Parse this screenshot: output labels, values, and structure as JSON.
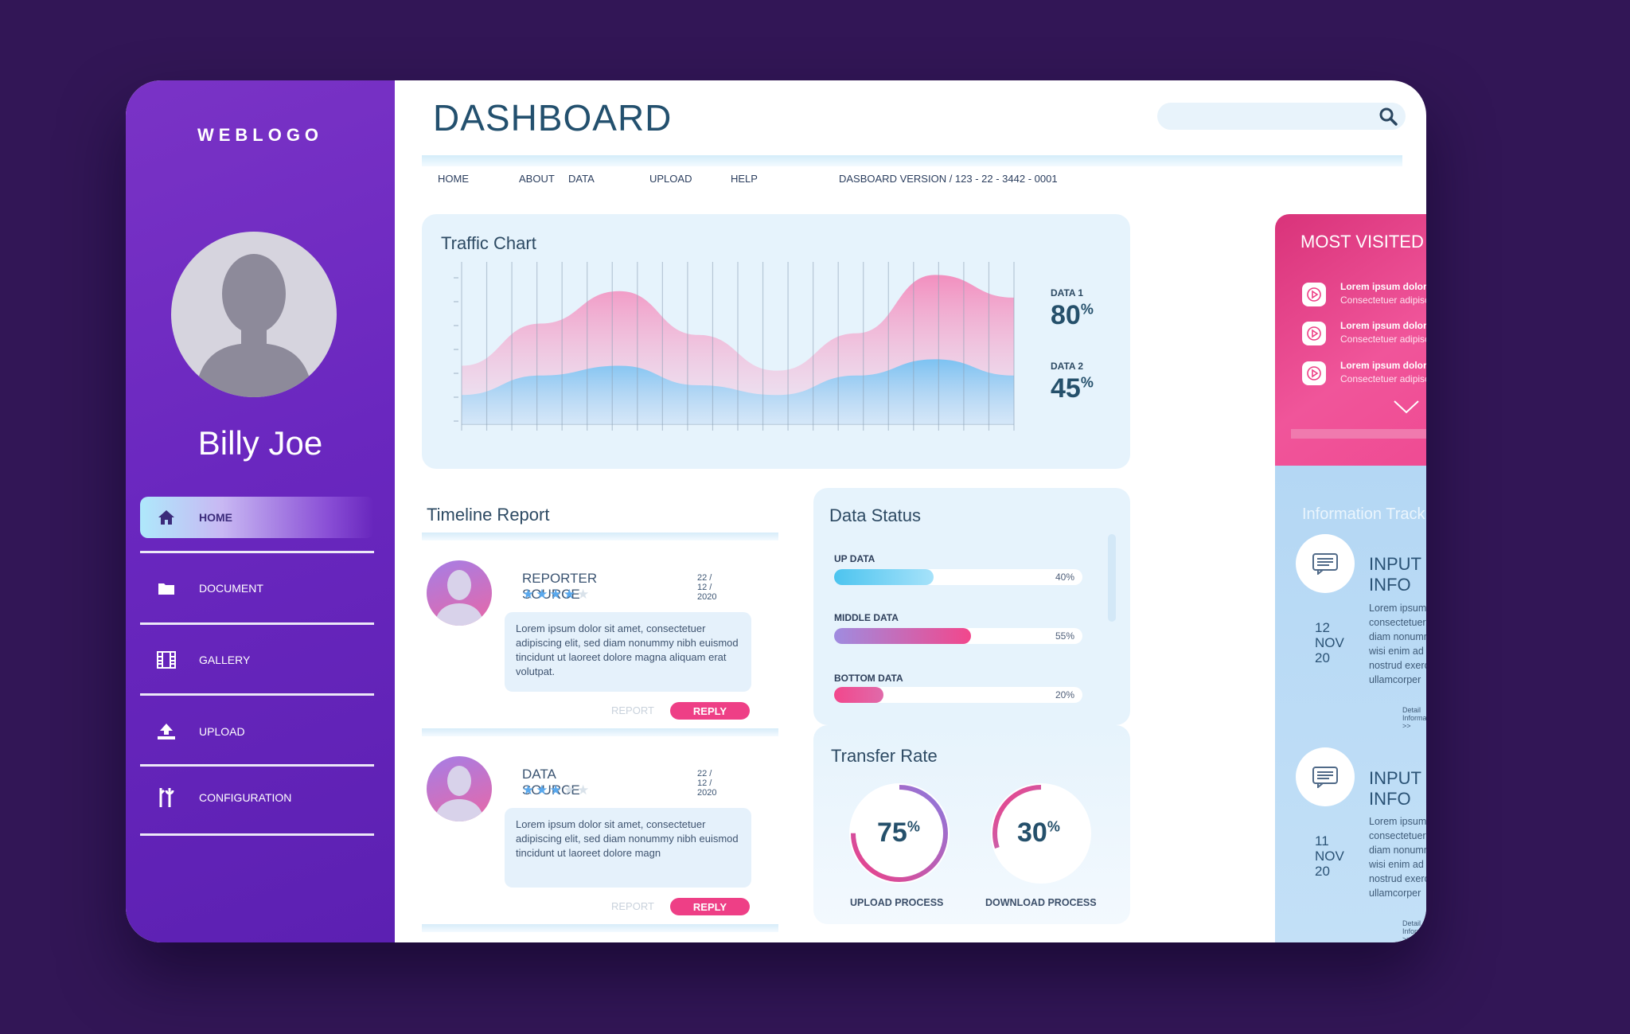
{
  "sidebar": {
    "logo": "WEBLOGO",
    "user_name": "Billy Joe",
    "items": [
      {
        "label": "HOME",
        "icon": "home-icon"
      },
      {
        "label": "DOCUMENT",
        "icon": "folder-icon"
      },
      {
        "label": "GALLERY",
        "icon": "film-icon"
      },
      {
        "label": "UPLOAD",
        "icon": "upload-icon"
      },
      {
        "label": "CONFIGURATION",
        "icon": "tools-icon"
      }
    ]
  },
  "header": {
    "title": "DASHBOARD",
    "search_placeholder": "",
    "nav": [
      "HOME",
      "ABOUT",
      "DATA",
      "UPLOAD",
      "HELP"
    ],
    "version": "DASBOARD VERSION / 123 - 22 - 3442 - 0001"
  },
  "traffic": {
    "title": "Traffic Chart",
    "data1_label": "DATA 1",
    "data1_value": "80",
    "data2_label": "DATA 2",
    "data2_value": "45",
    "pct": "%"
  },
  "chart_data": {
    "type": "area",
    "series": [
      {
        "values": [
          0.36,
          0.62,
          0.82,
          0.55,
          0.33,
          0.56,
          0.92,
          0.78
        ]
      },
      {
        "values": [
          0.18,
          0.3,
          0.36,
          0.24,
          0.18,
          0.3,
          0.4,
          0.3
        ]
      }
    ]
  },
  "most_visited": {
    "title": "MOST VISITED",
    "items": [
      {
        "title": "Lorem ipsum dolor",
        "subtitle": "Consectetuer adipiscing elit,"
      },
      {
        "title": "Lorem ipsum dolor",
        "subtitle": "Consectetuer adipiscing elit,"
      },
      {
        "title": "Lorem ipsum dolor",
        "subtitle": "Consectetuer adipiscing elit,"
      }
    ]
  },
  "timeline": {
    "title": "Timeline Report",
    "items": [
      {
        "source": "REPORTER SOURCE",
        "date": "22 / 12 / 2020",
        "stars": 4,
        "text": "Lorem ipsum dolor sit amet, consectetuer adipiscing elit, sed diam nonummy nibh euismod tincidunt ut laoreet dolore magna aliquam erat volutpat.",
        "report": "REPORT",
        "reply": "REPLY"
      },
      {
        "source": "DATA SOURCE",
        "date": "22 / 12 / 2020",
        "stars": 3,
        "text": "Lorem ipsum dolor sit amet, consectetuer adipiscing elit, sed diam nonummy nibh euismod tincidunt ut laoreet dolore magn",
        "report": "REPORT",
        "reply": "REPLY"
      }
    ]
  },
  "data_status": {
    "title": "Data Status",
    "rows": [
      {
        "label": "UP DATA",
        "pct": "40%",
        "value": 0.4
      },
      {
        "label": "MIDDLE DATA",
        "pct": "55%",
        "value": 0.55
      },
      {
        "label": "BOTTOM DATA",
        "pct": "20%",
        "value": 0.2
      }
    ]
  },
  "transfer": {
    "title": "Transfer Rate",
    "upload_value": "75",
    "upload_label": "UPLOAD PROCESS",
    "upload_level": 0.75,
    "download_value": "30",
    "download_label": "DOWNLOAD PROCESS",
    "download_level": 0.3,
    "pct": "%"
  },
  "info_track": {
    "title": "Information Track",
    "items": [
      {
        "heading": "INPUT INFO",
        "day": "12",
        "month": "NOV",
        "year": "20",
        "text": "Lorem ipsum dolor sit amet, consectetuer adipiscing elit, sed diam nonummy erat volutpat. Ut wisi enim ad minim veniam, quis nostrud exerci tation ullamcorper",
        "link": "Detail Information >>"
      },
      {
        "heading": "INPUT INFO",
        "day": "11",
        "month": "NOV",
        "year": "20",
        "text": "Lorem ipsum dolor sit amet, consectetuer adipiscing elit, sed diam nonummy erat volutpat. Ut wisi enim ad minim veniam, quis nostrud exerci tation ullamcorper",
        "link": "Detail Information >>"
      }
    ]
  },
  "colors": {
    "background": "#321656",
    "sidebar": "#6a27bf",
    "pink": "#ee3f86",
    "cyan": "#4cc4ef",
    "title": "#23506e"
  }
}
